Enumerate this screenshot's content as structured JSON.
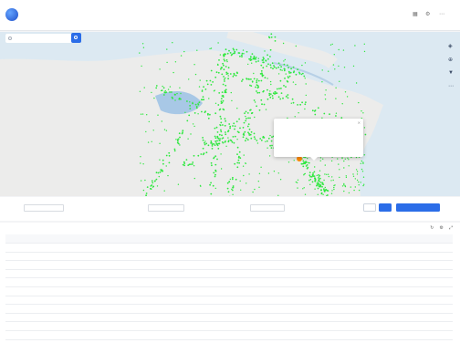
{
  "brand": {
    "name": "",
    "sub": ""
  },
  "nav": [
    "",
    "",
    "",
    "",
    "",
    ""
  ],
  "topbar": {
    "icons": [
      "grid-icon",
      "settings-icon",
      "more-icon"
    ]
  },
  "map": {
    "search_placeholder": "",
    "popup": {
      "lines": [
        "",
        "",
        "",
        "",
        ""
      ]
    },
    "tools": [
      "layers-icon",
      "locate-icon",
      "filter-icon",
      "more-icon"
    ]
  },
  "filter": {
    "l1": "",
    "p1": "",
    "l2": "",
    "p2": "",
    "l3": "",
    "p3": "",
    "reset": "",
    "query": "",
    "add": "",
    "more": ""
  },
  "table": {
    "title": "",
    "columns": [
      "",
      "",
      "",
      "",
      "",
      "",
      "",
      "",
      "",
      "",
      "",
      "",
      "",
      "",
      "",
      "",
      ""
    ],
    "rows": [
      [
        "",
        "",
        "",
        "",
        "",
        "",
        "",
        "",
        "",
        "",
        "",
        "",
        "",
        "",
        "",
        "",
        ""
      ],
      [
        "",
        "",
        "",
        "",
        "",
        "",
        "",
        "",
        "",
        "",
        "",
        "",
        "",
        "",
        "",
        "",
        ""
      ],
      [
        "",
        "",
        "",
        "",
        "",
        "",
        "",
        "",
        "",
        "",
        "",
        "",
        "",
        "",
        "",
        "",
        ""
      ],
      [
        "",
        "",
        "",
        "",
        "",
        "",
        "",
        "",
        "",
        "",
        "",
        "",
        "",
        "",
        "",
        "",
        ""
      ],
      [
        "",
        "",
        "",
        "",
        "",
        "",
        "",
        "",
        "",
        "",
        "",
        "",
        "",
        "",
        "",
        "",
        ""
      ],
      [
        "",
        "",
        "",
        "",
        "",
        "",
        "",
        "",
        "",
        "",
        "",
        "",
        "",
        "",
        "",
        "",
        ""
      ],
      [
        "",
        "",
        "",
        "",
        "",
        "",
        "",
        "",
        "",
        "",
        "",
        "",
        "",
        "",
        "",
        "",
        ""
      ],
      [
        "",
        "",
        "",
        "",
        "",
        "",
        "",
        "",
        "",
        "",
        "",
        "",
        "",
        "",
        "",
        "",
        ""
      ],
      [
        "",
        "",
        "",
        "",
        "",
        "",
        "",
        "",
        "",
        "",
        "",
        "",
        "",
        "",
        "",
        "",
        ""
      ],
      [
        "",
        "",
        "",
        "",
        "",
        "",
        "",
        "",
        "",
        "",
        "",
        "",
        "",
        "",
        "",
        "",
        ""
      ],
      [
        "",
        "",
        "",
        "",
        "",
        "",
        "",
        "",
        "",
        "",
        "",
        "",
        "",
        "",
        "",
        "",
        ""
      ]
    ]
  },
  "colors": {
    "accent": "#2b6de8",
    "dots": "#2ee83f",
    "sea": "#dce9f2",
    "land": "#ececeb"
  }
}
